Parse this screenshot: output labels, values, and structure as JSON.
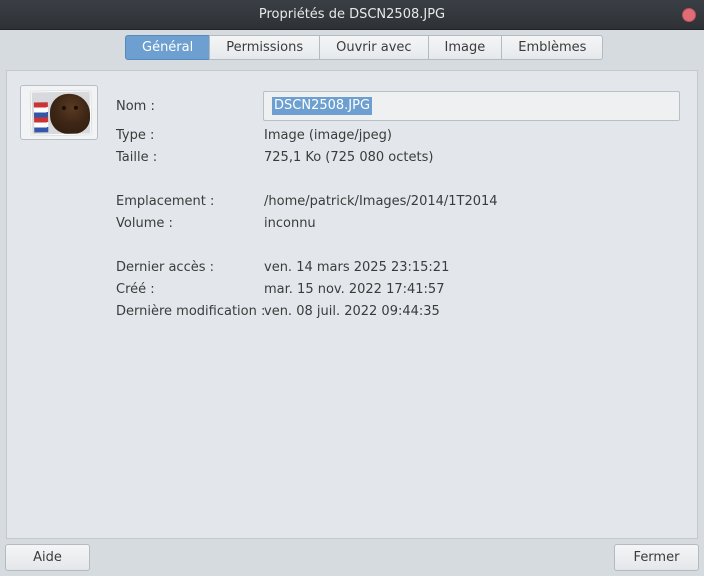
{
  "window": {
    "title": "Propriétés de DSCN2508.JPG"
  },
  "tabs": [
    {
      "label": "Général",
      "active": true
    },
    {
      "label": "Permissions",
      "active": false
    },
    {
      "label": "Ouvrir avec",
      "active": false
    },
    {
      "label": "Image",
      "active": false
    },
    {
      "label": "Emblèmes",
      "active": false
    }
  ],
  "general": {
    "name_label": "Nom :",
    "name_value": "DSCN2508.JPG",
    "type_label": "Type :",
    "type_value": "Image (image/jpeg)",
    "size_label": "Taille :",
    "size_value": "725,1 Ko (725 080 octets)",
    "location_label": "Emplacement :",
    "location_value": "/home/patrick/Images/2014/1T2014",
    "volume_label": "Volume :",
    "volume_value": "inconnu",
    "accessed_label": "Dernier accès :",
    "accessed_value": "ven. 14 mars 2025 23:15:21",
    "created_label": "Créé :",
    "created_value": "mar. 15 nov. 2022 17:41:57",
    "modified_label": "Dernière modification :",
    "modified_value": "ven. 08 juil. 2022 09:44:35"
  },
  "buttons": {
    "help": "Aide",
    "close": "Fermer"
  },
  "colors": {
    "accent": "#6d9fd0",
    "titlebar": "#33373c",
    "close_dot": "#e06c75"
  }
}
